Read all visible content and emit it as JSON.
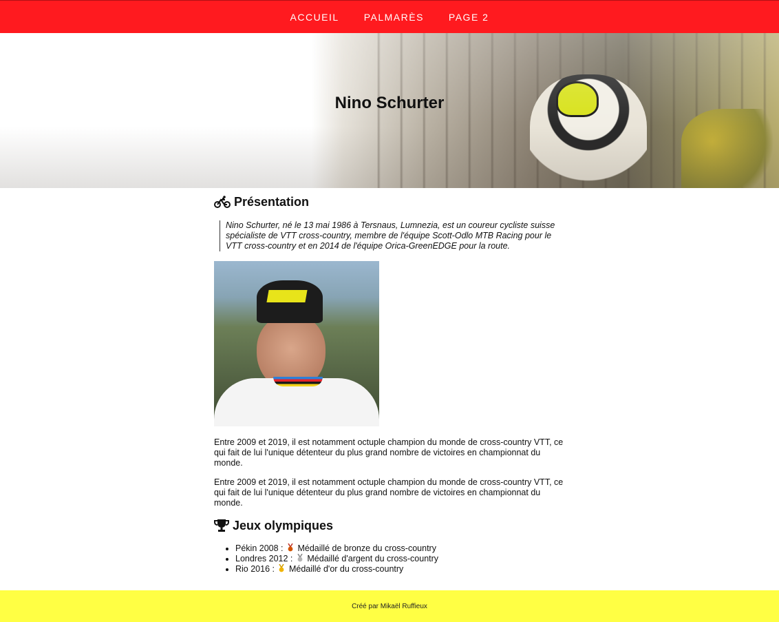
{
  "nav": {
    "items": [
      "ACCUEIL",
      "PALMARÈS",
      "PAGE 2"
    ]
  },
  "hero": {
    "title": "Nino Schurter"
  },
  "presentation": {
    "heading": "Présentation",
    "icon": "bicycle-icon",
    "quote": "Nino Schurter, né le 13 mai 1986 à Tersnaus, Lumnezia, est un coureur cycliste suisse spécialiste de VTT cross-country, membre de l'équipe Scott-Odlo MTB Racing pour le VTT cross-country et en 2014 de l'équipe Orica-GreenEDGE pour la route.",
    "paragraphs": [
      "Entre 2009 et 2019, il est notamment octuple champion du monde de cross-country VTT, ce qui fait de lui l'unique détenteur du plus grand nombre de victoires en championnat du monde.",
      "Entre 2009 et 2019, il est notamment octuple champion du monde de cross-country VTT, ce qui fait de lui l'unique détenteur du plus grand nombre de victoires en championnat du monde."
    ]
  },
  "olympics": {
    "heading": "Jeux olympiques",
    "icon": "trophy-icon",
    "items": [
      {
        "place": "Pékin 2008 :",
        "text": "Médaillé de bronze du cross-country",
        "medal": "bronze-medal-icon",
        "color": "#c0392b"
      },
      {
        "place": "Londres 2012 :",
        "text": "Médaillé d'argent du cross-country",
        "medal": "silver-medal-icon",
        "color": "#9e9e9e"
      },
      {
        "place": "Rio 2016 :",
        "text": "Médaillé d'or du cross-country",
        "medal": "gold-medal-icon",
        "color": "#f0b400"
      }
    ]
  },
  "footer": {
    "text": "Créé par Mikaël Ruffieux"
  },
  "colors": {
    "nav_bg": "#ff1a1f",
    "footer_bg": "#ffff44"
  }
}
